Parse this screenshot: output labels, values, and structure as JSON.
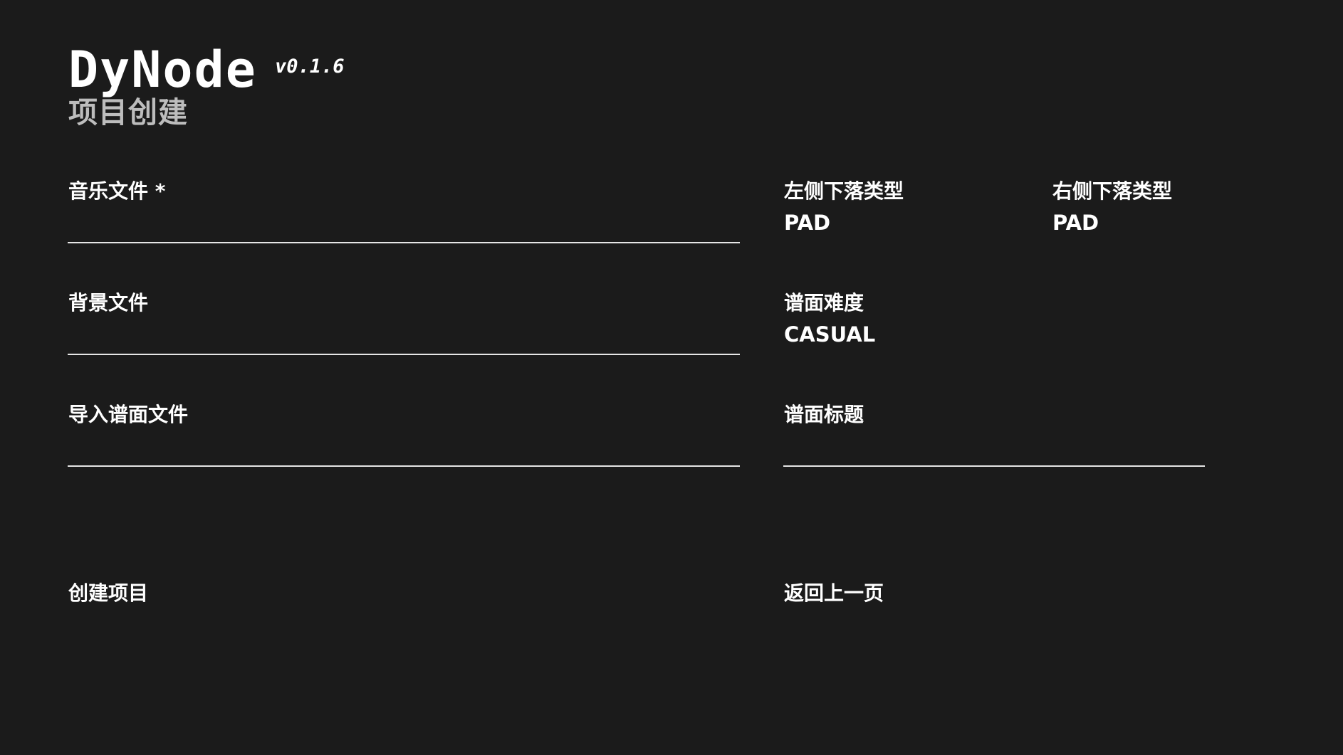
{
  "header": {
    "app_name": "DyNode",
    "version": "v0.1.6",
    "page_title": "项目创建"
  },
  "form": {
    "music_file": {
      "label": "音乐文件 *",
      "value": ""
    },
    "background_file": {
      "label": "背景文件",
      "value": ""
    },
    "import_chart_file": {
      "label": "导入谱面文件",
      "value": ""
    },
    "left_drop_type": {
      "label": "左侧下落类型",
      "value": "PAD"
    },
    "right_drop_type": {
      "label": "右侧下落类型",
      "value": "PAD"
    },
    "chart_difficulty": {
      "label": "谱面难度",
      "value": "CASUAL"
    },
    "chart_title": {
      "label": "谱面标题",
      "value": ""
    }
  },
  "actions": {
    "create_project": "创建项目",
    "back": "返回上一页"
  },
  "colors": {
    "background": "#1b1b1b",
    "text": "#ffffff",
    "subtitle": "#bdbdbd",
    "underline": "#e6e6e6"
  }
}
